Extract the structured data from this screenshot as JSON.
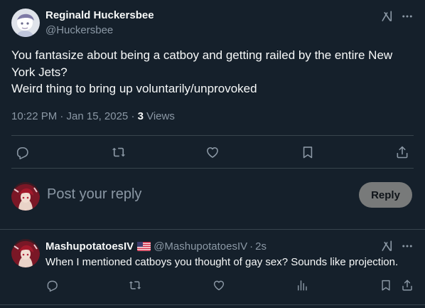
{
  "main_tweet": {
    "author_name": "Reginald Huckersbee",
    "author_handle": "@Huckersbee",
    "text_lines": [
      "You fantasize about being a catboy and getting railed by the entire New",
      "York Jets?",
      "Weird thing to bring up voluntarily/unprovoked"
    ],
    "timestamp": "10:22 PM · Jan 15, 2025 · ",
    "views_count": "3",
    "views_label": " Views",
    "actions": [
      "reply-icon",
      "retweet-icon",
      "like-icon",
      "bookmark-icon",
      "share-icon"
    ]
  },
  "composer": {
    "placeholder": "Post your reply",
    "button_label": "Reply"
  },
  "reply_tweet": {
    "author_name": "MashupotatoesIV",
    "flag": "us-flag-icon",
    "author_handle": "@MashupotatoesIV",
    "dot": "·",
    "time": "2s",
    "text": "When I mentioned catboys you thought of gay sex? Sounds like projection.",
    "actions": [
      "reply-icon",
      "retweet-icon",
      "like-icon",
      "analytics-icon",
      "bookmark-icon",
      "share-icon"
    ]
  },
  "colors": {
    "background": "#15202b",
    "primary_text": "#f7f9f9",
    "secondary_text": "#8b98a5",
    "divider": "#38444d",
    "reply_button_disabled": "#787a7a"
  }
}
